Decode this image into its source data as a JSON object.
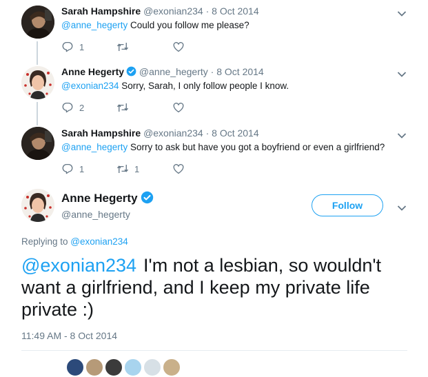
{
  "tweets": [
    {
      "name": "Sarah Hampshire",
      "handle": "@exonian234",
      "separator": "·",
      "date": "8 Oct 2014",
      "mention": "@anne_hegerty",
      "text": " Could you follow me please?",
      "reply_count": "1",
      "retweet_count": "",
      "like_count": ""
    },
    {
      "name": "Anne Hegerty",
      "handle": "@anne_hegerty",
      "separator": "·",
      "date": "8 Oct 2014",
      "mention": "@exonian234",
      "text": "  Sorry, Sarah, I only follow people I know.",
      "reply_count": "2",
      "retweet_count": "",
      "like_count": ""
    },
    {
      "name": "Sarah Hampshire",
      "handle": "@exonian234",
      "separator": "·",
      "date": "8 Oct 2014",
      "mention": "@anne_hegerty",
      "text": " Sorry to ask but have you got a boyfriend or even a girlfriend?",
      "reply_count": "1",
      "retweet_count": "1",
      "like_count": ""
    }
  ],
  "main_tweet": {
    "name": "Anne Hegerty",
    "handle": "@anne_hegerty",
    "follow_label": "Follow",
    "replying_prefix": "Replying to ",
    "replying_to": "@exonian234",
    "mention": "@exonian234",
    "text": "I'm not a lesbian, so wouldn't want a girlfriend, and I keep my private life private :)",
    "timestamp": "11:49 AM - 8 Oct 2014"
  },
  "colors": {
    "accent": "#1da1f2",
    "secondary_text": "#657786",
    "primary_text": "#14171a",
    "thread_line": "#ccd6dd"
  },
  "icons": {
    "reply": "reply-icon",
    "retweet": "retweet-icon",
    "like": "heart-icon",
    "menu": "chevron-down-icon",
    "verified": "verified-badge-icon"
  }
}
